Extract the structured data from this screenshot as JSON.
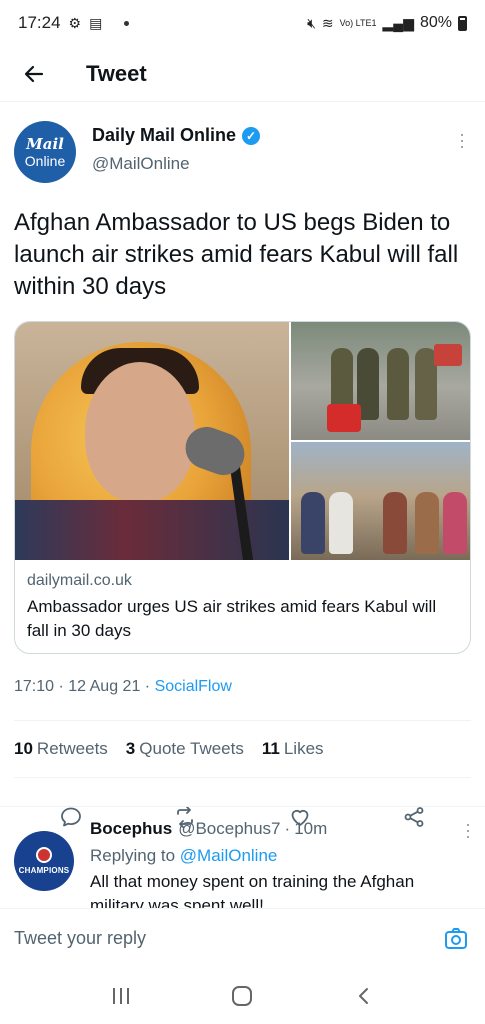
{
  "status_bar": {
    "time": "17:24",
    "news_icon": "news-icon",
    "battery": "80%",
    "network": "Vo) LTE1"
  },
  "header": {
    "title": "Tweet",
    "back_icon": "arrow-left-icon"
  },
  "tweet": {
    "author_name": "Daily Mail Online",
    "author_handle": "@MailOnline",
    "avatar_line1": "Mail",
    "avatar_line2": "Online",
    "text": "Afghan Ambassador to US begs Biden to launch air strikes amid fears Kabul will fall within 30 days",
    "card": {
      "domain": "dailymail.co.uk",
      "title": "Ambassador urges US air strikes amid fears Kabul will fall in 30 days"
    },
    "time": "17:10",
    "date": "12 Aug 21",
    "source": "SocialFlow",
    "stats": {
      "retweets_count": "10",
      "retweets_label": "Retweets",
      "quotes_count": "3",
      "quotes_label": "Quote Tweets",
      "likes_count": "11",
      "likes_label": "Likes"
    }
  },
  "reply": {
    "name": "Bocephus",
    "handle": "@Bocephus7",
    "age": "10m",
    "replying_label": "Replying to",
    "replying_to": "@MailOnline",
    "text": "All that money spent on training the Afghan military was spent well!",
    "avatar_text": "CHAMPIONS"
  },
  "compose": {
    "placeholder": "Tweet your reply"
  },
  "colors": {
    "accent": "#1d9bf0",
    "secondary_text": "#536471",
    "mail_blue": "#1f5fa8"
  }
}
